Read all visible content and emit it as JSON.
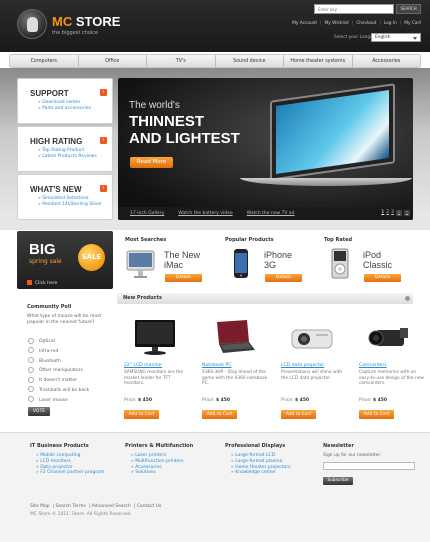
{
  "header": {
    "logo_mc": "MC",
    "logo_store": "STORE",
    "tagline": "the biggest choice",
    "search_placeholder": "Enter key",
    "search_button": "SEARCH",
    "top_links": [
      "My Account",
      "My Wishlist",
      "Checkout",
      "Log In",
      "My Cart"
    ],
    "language_label": "Select your Language",
    "language_value": "English"
  },
  "nav": [
    "Computers",
    "Office",
    "TV's",
    "Sound device",
    "Home theater systems",
    "Accessories"
  ],
  "sidebar": [
    {
      "title": "SUPPORT",
      "links": [
        "Download center",
        "Parts and accessories"
      ]
    },
    {
      "title": "HIGH RATING",
      "links": [
        "Top Rating Product",
        "Latest Products Reviews"
      ]
    },
    {
      "title": "WHAT'S NEW",
      "links": [
        "Simulated Setsstone",
        "Pendant 14kSterling Silver"
      ]
    }
  ],
  "hero": {
    "line1": "The world's",
    "line2": "THINNEST",
    "line3": "AND LIGHTEST",
    "button": "Read More",
    "strip_links": [
      "17-inch Gallery",
      "Watch the battery video",
      "Watch the new TV ad"
    ],
    "pager": [
      "1",
      "2",
      "3"
    ]
  },
  "big_sale": {
    "title": "BIG",
    "subtitle": "spring sale",
    "badge": "SALE",
    "link": "Click here"
  },
  "categories": [
    {
      "heading": "Most Searches",
      "name_line1": "The New",
      "name_line2": "iMac",
      "button": "Details"
    },
    {
      "heading": "Popular Products",
      "name_line1": "iPhone",
      "name_line2": "3G",
      "button": "Details"
    },
    {
      "heading": "Top Rated",
      "name_line1": "iPod",
      "name_line2": "Classic",
      "button": "Details"
    }
  ],
  "poll": {
    "heading": "Community Poll",
    "question": "What type of mouse will be most popular in the nearest future?",
    "options": [
      "Optical",
      "Infra-red",
      "Bluetooth",
      "Other manipulators",
      "It doesn't matter",
      "Trackballs will be back",
      "Laser mouse"
    ],
    "vote_button": "VOTE"
  },
  "new_products": {
    "heading": "New Products",
    "items": [
      {
        "name": "22\" LCD monitor",
        "desc": "SAMSUNG monitors are the market leader for TFT monitors.",
        "price_label": "Price:",
        "price": "$ 450",
        "button": "Add to Cart"
      },
      {
        "name": "Notebook PC",
        "desc": "X360-3HP - Stay ahead of the game with the X360 notebook PC.",
        "price_label": "Price:",
        "price": "$ 450",
        "button": "Add to Cart"
      },
      {
        "name": "LCD data projector",
        "desc": "Presentations will shine with the LCD data projector.",
        "price_label": "Price:",
        "price": "$ 450",
        "button": "Add to Cart"
      },
      {
        "name": "Camcorders",
        "desc": "Capture memories with an easy-to-use design of the new camcorders.",
        "price_label": "Price:",
        "price": "$ 450",
        "button": "Add to Cart"
      }
    ]
  },
  "footer": {
    "columns": [
      {
        "title": "IT Business Products",
        "links": [
          "Mobile computing",
          "LCD monitors",
          "Data projector",
          "F2 Channel partner program"
        ]
      },
      {
        "title": "Printers & Multifunction",
        "links": [
          "Laser printers",
          "Multifunction printers",
          "Accessories",
          "Solutions"
        ]
      },
      {
        "title": "Professional Displays",
        "links": [
          "Large-format LCD",
          "Large-format plasma",
          "Home theater projectors",
          "Knowledge center"
        ]
      }
    ],
    "newsletter_title": "Newsletter",
    "newsletter_text": "Sign up for our newsletter",
    "subscribe": "Subscribe",
    "bottom_links": [
      "Site Map",
      "Search Terms",
      "Advanced Search",
      "Contact Us"
    ],
    "copyright": "MC Store © 2011. Store. All Rights Reserved."
  },
  "colors": {
    "accent": "#ec5a24",
    "link": "#2a8ccf",
    "header_bg": "#222222"
  }
}
